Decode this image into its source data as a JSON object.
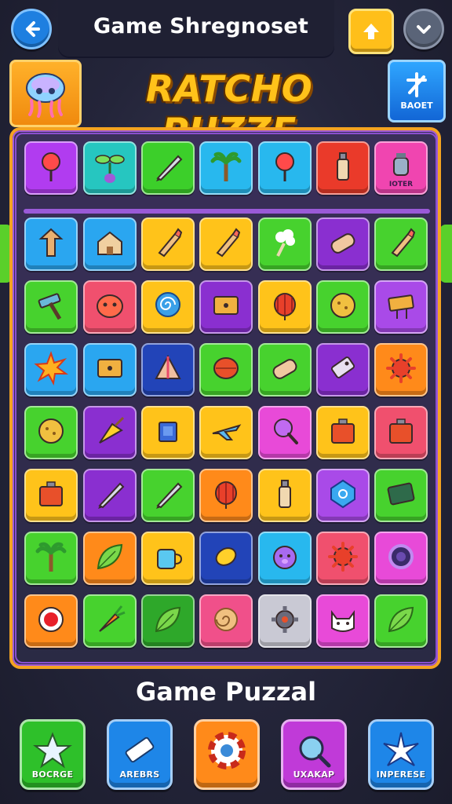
{
  "header": {
    "title": "Game Shregnoset",
    "back_icon": "arrow-left-icon",
    "up_icon": "arrow-up-icon",
    "down_icon": "chevron-down-icon"
  },
  "banner": {
    "game_title": "RATCHO PUZZE",
    "logo_icon": "jellyfish-icon",
    "badge_icon": "star-burst-icon",
    "badge_label": "BAOET"
  },
  "board": {
    "rows": [
      [
        {
          "icon": "lollipop-icon",
          "color": "#b13cf0"
        },
        {
          "icon": "sprout-icon",
          "color": "#26c6c0"
        },
        {
          "icon": "pencil-icon",
          "color": "#3ccf2a"
        },
        {
          "icon": "palm-tree-icon",
          "color": "#28b8ee"
        },
        {
          "icon": "lollipop-icon",
          "color": "#28b8ee"
        },
        {
          "icon": "bottle-icon",
          "color": "#ea3a2a"
        },
        {
          "icon": "jar-icon",
          "color": "#f045b0",
          "label": "IOTER"
        }
      ],
      [
        {
          "icon": "arrow-pillar-icon",
          "color": "#2aa6f0"
        },
        {
          "icon": "house-icon",
          "color": "#2aa6f0"
        },
        {
          "icon": "brush-icon",
          "color": "#ffc31a"
        },
        {
          "icon": "brush-icon",
          "color": "#ffc31a"
        },
        {
          "icon": "cotton-icon",
          "color": "#47d22e"
        },
        {
          "icon": "battery-icon",
          "color": "#8a2fd0"
        },
        {
          "icon": "syringe-icon",
          "color": "#47d22e"
        }
      ],
      [
        {
          "icon": "hammer-icon",
          "color": "#47d22e"
        },
        {
          "icon": "blob-face-icon",
          "color": "#f0506e"
        },
        {
          "icon": "spiral-candy-icon",
          "color": "#ffc31a"
        },
        {
          "icon": "box-icon",
          "color": "#8a2fd0"
        },
        {
          "icon": "lantern-icon",
          "color": "#ffc31a"
        },
        {
          "icon": "cookie-icon",
          "color": "#47d22e"
        },
        {
          "icon": "sign-icon",
          "color": "#a94ae8"
        }
      ],
      [
        {
          "icon": "burst-icon",
          "color": "#2aa6f0"
        },
        {
          "icon": "screen-icon",
          "color": "#2aa6f0"
        },
        {
          "icon": "tent-icon",
          "color": "#2244b8"
        },
        {
          "icon": "leaf-ball-icon",
          "color": "#47d22e"
        },
        {
          "icon": "capsule-icon",
          "color": "#47d22e"
        },
        {
          "icon": "tag-icon",
          "color": "#8a2fd0"
        },
        {
          "icon": "virus-icon",
          "color": "#ff8a1a"
        }
      ],
      [
        {
          "icon": "acorn-icon",
          "color": "#47d22e"
        },
        {
          "icon": "broom-icon",
          "color": "#8a2fd0"
        },
        {
          "icon": "cube-icon",
          "color": "#ffc31a"
        },
        {
          "icon": "plane-icon",
          "color": "#ffc31a"
        },
        {
          "icon": "magnifier-icon",
          "color": "#e84ad8"
        },
        {
          "icon": "toaster-icon",
          "color": "#ffc31a"
        },
        {
          "icon": "lock-box-icon",
          "color": "#f0506e"
        }
      ],
      [
        {
          "icon": "briefcase-icon",
          "color": "#ffc31a"
        },
        {
          "icon": "pen-icon",
          "color": "#8a2fd0"
        },
        {
          "icon": "knife-icon",
          "color": "#47d22e"
        },
        {
          "icon": "lantern-icon",
          "color": "#ff8a1a"
        },
        {
          "icon": "bottle-icon",
          "color": "#ffc31a"
        },
        {
          "icon": "gem-icon",
          "color": "#a94ae8"
        },
        {
          "icon": "card-icon",
          "color": "#47d22e"
        }
      ],
      [
        {
          "icon": "tree-icon",
          "color": "#47d22e"
        },
        {
          "icon": "leaf-icon",
          "color": "#ff8a1a"
        },
        {
          "icon": "mug-icon",
          "color": "#ffc31a"
        },
        {
          "icon": "lemon-icon",
          "color": "#2244b8"
        },
        {
          "icon": "pig-icon",
          "color": "#28b8ee"
        },
        {
          "icon": "gear-flower-icon",
          "color": "#f0506e"
        },
        {
          "icon": "ring-icon",
          "color": "#e84ad8"
        }
      ],
      [
        {
          "icon": "chip-icon",
          "color": "#ff8a1a"
        },
        {
          "icon": "carrot-icon",
          "color": "#47d22e"
        },
        {
          "icon": "leaf-icon",
          "color": "#2ea82a"
        },
        {
          "icon": "shell-icon",
          "color": "#f0508a"
        },
        {
          "icon": "gear-icon",
          "color": "#c9c9d4"
        },
        {
          "icon": "cat-face-icon",
          "color": "#e84ad8"
        },
        {
          "icon": "feather-icon",
          "color": "#47d22e"
        }
      ]
    ]
  },
  "footer": {
    "title": "Game Puzzal",
    "buttons": [
      {
        "label": "BOCRGE",
        "icon": "star-icon",
        "color": "#2ec02a"
      },
      {
        "label": "AREBRS",
        "icon": "eraser-icon",
        "color": "#1e86e8"
      },
      {
        "label": "",
        "icon": "life-ring-icon",
        "color": "#ff8a1a"
      },
      {
        "label": "UXAKAP",
        "icon": "magnifier-icon",
        "color": "#c03ad8"
      },
      {
        "label": "INPERESE",
        "icon": "sparkle-star-icon",
        "color": "#1e86e8"
      }
    ]
  }
}
